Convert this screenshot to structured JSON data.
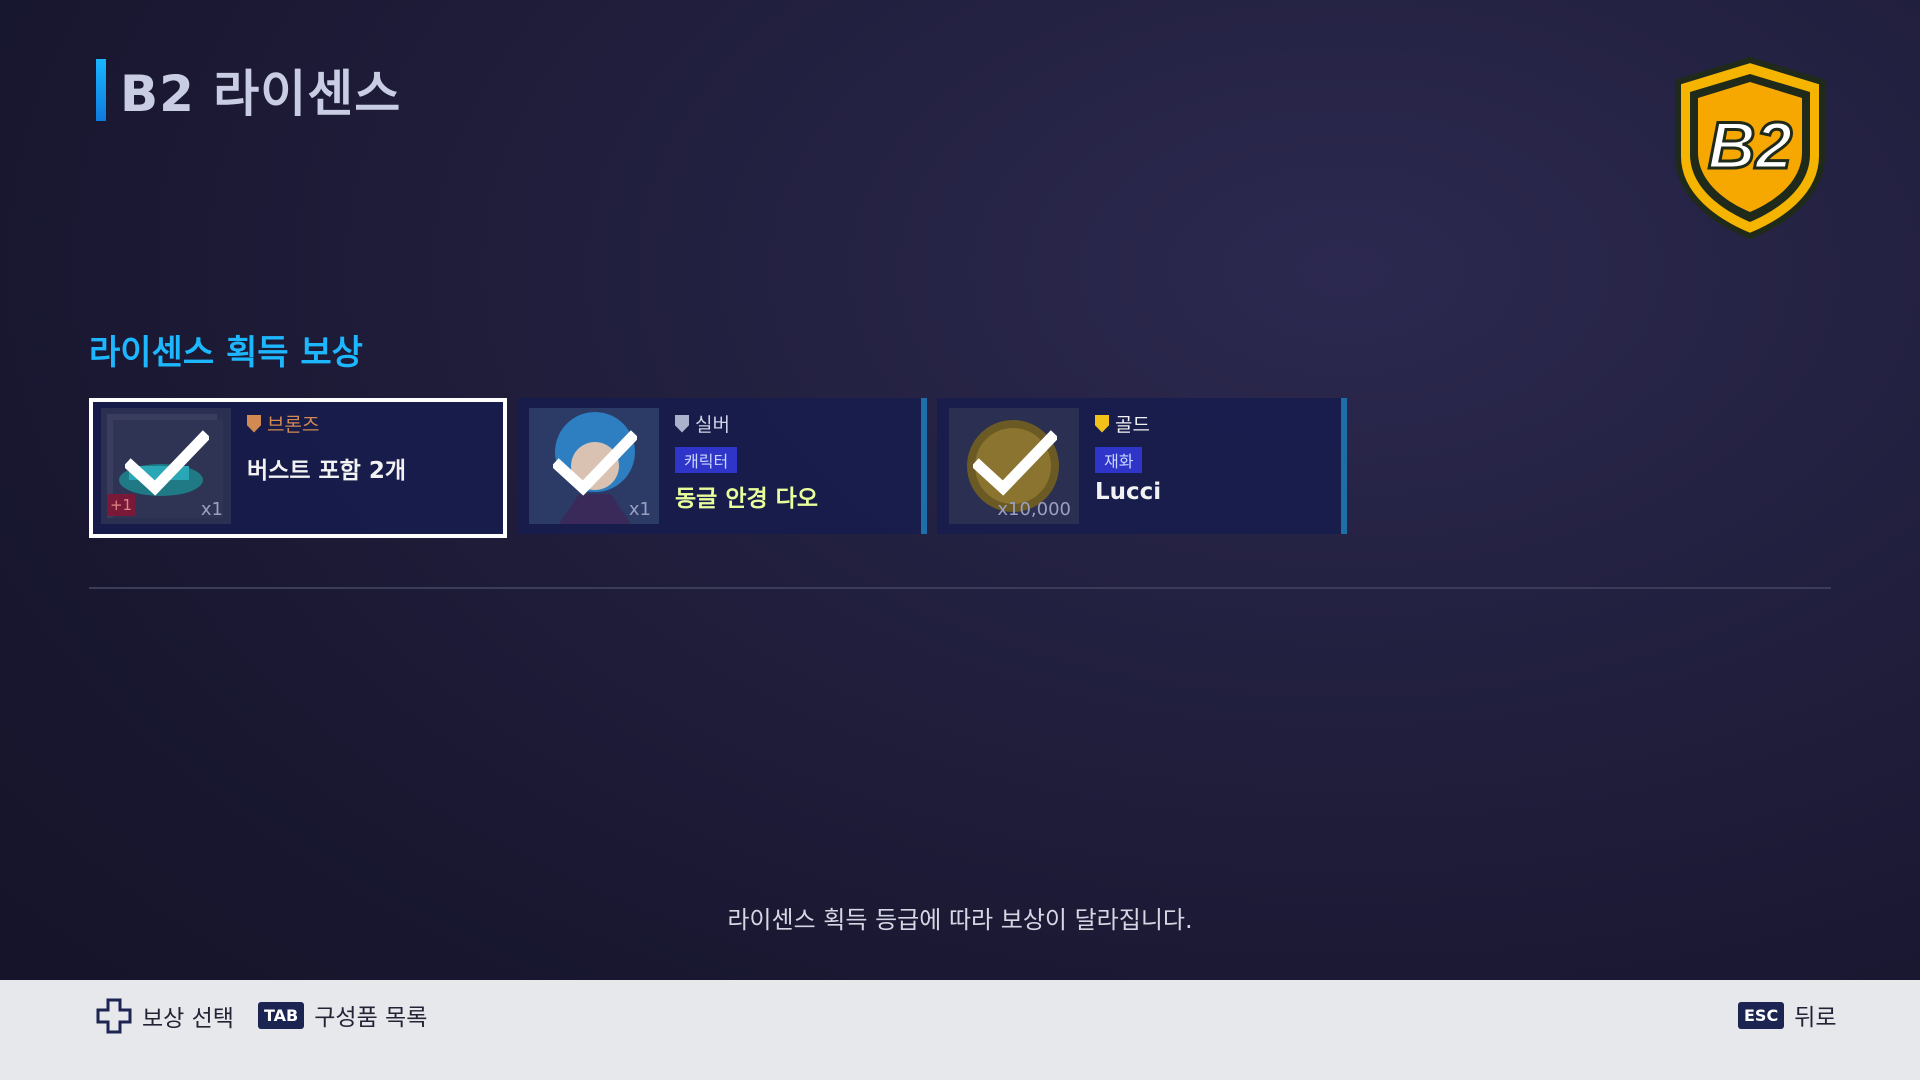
{
  "header": {
    "title": "B2 라이센스"
  },
  "badge": {
    "label": "B2",
    "colors": {
      "gold": "#f5b400",
      "outline": "#1f2a1a"
    }
  },
  "section": {
    "title": "라이센스 획득 보상"
  },
  "rewards": [
    {
      "tier": "브론즈",
      "tier_color": "#d28a52",
      "tag": "",
      "name": "버스트 포함 2개",
      "qty": "x1",
      "plus": "+1",
      "claimed": true,
      "selected": true
    },
    {
      "tier": "실버",
      "tier_color": "#aab2cc",
      "tag": "캐릭터",
      "name": "동글 안경 다오",
      "qty": "x1",
      "claimed": true,
      "selected": false
    },
    {
      "tier": "골드",
      "tier_color": "#f2c21a",
      "tag": "재화",
      "name": "Lucci",
      "qty": "x10,000",
      "claimed": true,
      "selected": false
    }
  ],
  "notice": "라이센스 획득 등급에 따라 보상이 달라집니다.",
  "footer": {
    "select_label": "보상 선택",
    "tab_key": "TAB",
    "tab_label": "구성품 목록",
    "esc_key": "ESC",
    "esc_label": "뒤로"
  }
}
